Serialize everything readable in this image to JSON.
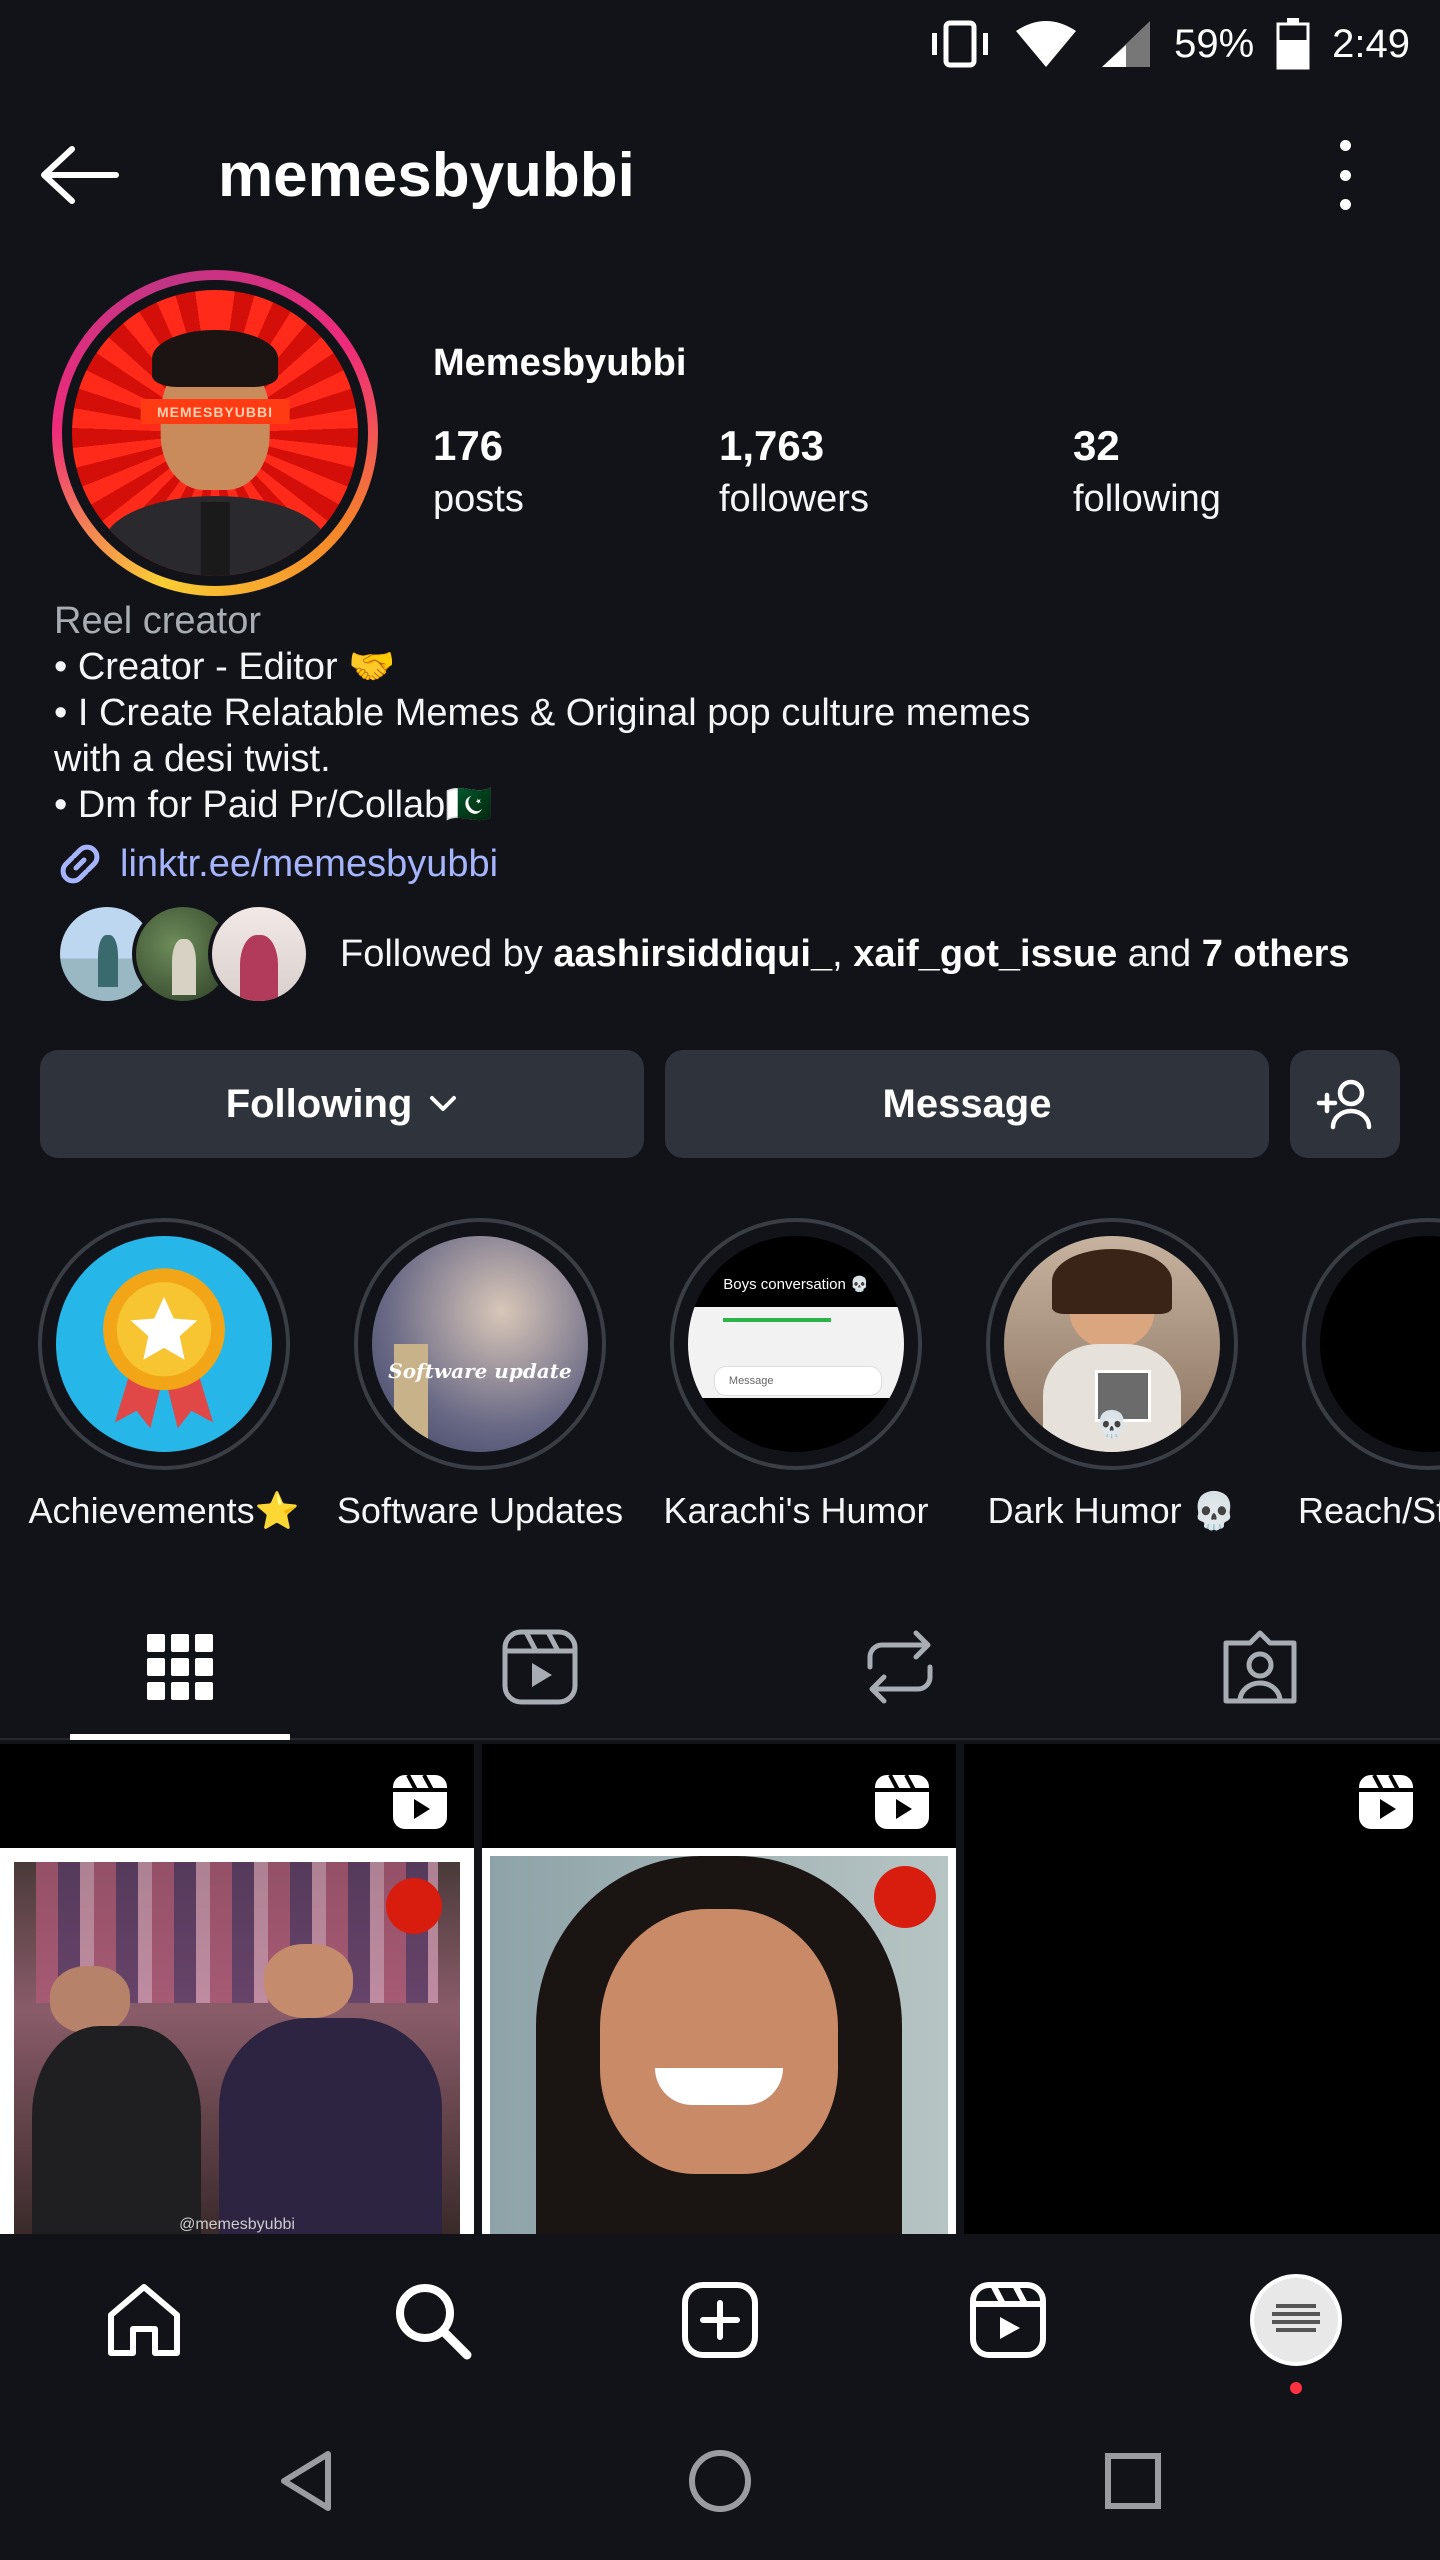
{
  "status_bar": {
    "battery": "59%",
    "time": "2:49"
  },
  "header": {
    "username": "memesbyubbi"
  },
  "profile": {
    "display_name": "Memesbyubbi",
    "avatar_text": "MEMESBYUBBI",
    "stats": [
      {
        "value": "176",
        "label": "posts"
      },
      {
        "value": "1,763",
        "label": "followers"
      },
      {
        "value": "32",
        "label": "following"
      }
    ],
    "category": "Reel creator",
    "bio_lines": [
      "• Creator - Editor 🤝",
      "• I Create Relatable Memes & Original pop culture memes",
      "with a desi twist.",
      "• Dm for Paid Pr/Collab🇵🇰"
    ],
    "link": "linktr.ee/memesbyubbi"
  },
  "followed_by": {
    "prefix": "Followed by ",
    "user1": "aashirsiddiqui_",
    "sep": ", ",
    "user2": "xaif_got_issue",
    "and": " and ",
    "others": "7 others"
  },
  "actions": {
    "following": "Following",
    "message": "Message"
  },
  "highlights": [
    {
      "label": "Achievements⭐"
    },
    {
      "label": "Software Updates",
      "overlay": "Software update"
    },
    {
      "label": "Karachi's Humor",
      "overlay": "Boys conversation 💀",
      "input_placeholder": "Message"
    },
    {
      "label": "Dark Humor 💀"
    },
    {
      "label": "Reach/St"
    }
  ],
  "grid": {
    "watermark": "@memesbyubbi"
  },
  "colors": {
    "background": "#111318",
    "button": "#2f333b",
    "link": "#a5b4fc",
    "notification": "#ff3040"
  }
}
